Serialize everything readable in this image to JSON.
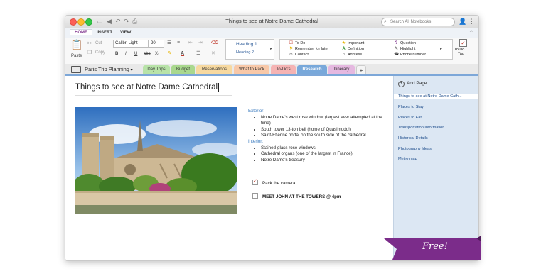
{
  "window": {
    "title": "Things to see at Notre Dame Cathedral",
    "search_placeholder": "Search All Notebooks"
  },
  "ribbon_tabs": [
    {
      "label": "HOME",
      "active": true
    },
    {
      "label": "INSERT",
      "active": false
    },
    {
      "label": "VIEW",
      "active": false
    }
  ],
  "ribbon": {
    "paste_label": "Paste",
    "cut_label": "Cut",
    "copy_label": "Copy",
    "font_name": "Calibri Light",
    "font_size": "20",
    "bold": "B",
    "italic": "I",
    "underline": "U",
    "strike": "abc",
    "subscript": "X₂",
    "styles": [
      "Heading 1",
      "Heading 2"
    ],
    "tags": [
      {
        "icon": "checkbox",
        "label": "To Do",
        "color": "#c0392b"
      },
      {
        "icon": "flag",
        "label": "Remember for later",
        "color": "#e6b400"
      },
      {
        "icon": "person",
        "label": "Contact",
        "color": "#555555"
      },
      {
        "icon": "star",
        "label": "Important",
        "color": "#e6b400"
      },
      {
        "icon": "A",
        "label": "Definition",
        "color": "#2a8a2a"
      },
      {
        "icon": "house",
        "label": "Address",
        "color": "#555555"
      },
      {
        "icon": "question",
        "label": "Question",
        "color": "#7b2c8a"
      },
      {
        "icon": "highlight",
        "label": "Highlight",
        "color": "#555555"
      },
      {
        "icon": "phone",
        "label": "Phone number",
        "color": "#555555"
      }
    ],
    "todo_tag_label_1": "To Do",
    "todo_tag_label_2": "Tag"
  },
  "notebook": {
    "name": "Paris Trip Planning",
    "sections": [
      {
        "label": "Day Trips",
        "color": "#b8e3a8"
      },
      {
        "label": "Budget",
        "color": "#a9d88e"
      },
      {
        "label": "Reservations",
        "color": "#f7d9a0"
      },
      {
        "label": "What to Pack",
        "color": "#f8c8a8"
      },
      {
        "label": "To-Do's",
        "color": "#f5b3b3"
      },
      {
        "label": "Research",
        "color": "#78a8da",
        "active": true
      },
      {
        "label": "Itinerary",
        "color": "#e5b8e0"
      },
      {
        "label": "+",
        "color": "#f4f4f4"
      }
    ]
  },
  "page": {
    "title": "Things to see at Notre Dame Cathedral",
    "exterior_heading": "Exterior:",
    "exterior_items": [
      "Notre Dame's west rose window (largest ever attempted at the time)",
      "South tower 13-ton bell (home of Quasimodo!)",
      "Saint-Etienne portal on the south side of the cathedral"
    ],
    "interior_heading": "Interior:",
    "interior_items": [
      "Stained-glass rose windows",
      "Cathedral organs (one of the largest in France)",
      "Notre Dame's treasury"
    ],
    "todos": [
      {
        "label": "Pack the camera",
        "checked": true
      },
      {
        "label": "MEET JOHN AT THE TOWERS @ 4pm",
        "checked": false
      }
    ]
  },
  "sidebar": {
    "add_page": "Add Page",
    "pages": [
      {
        "label": "Things to see at Notre Dame Cath...",
        "selected": true
      },
      {
        "label": "Places to Stay",
        "selected": false
      },
      {
        "label": "Places to Eat",
        "selected": false
      },
      {
        "label": "Transportation Information",
        "selected": false
      },
      {
        "label": "Historical Details",
        "selected": false
      },
      {
        "label": "Photography Ideas",
        "selected": false
      },
      {
        "label": "Metro map",
        "selected": false
      }
    ]
  },
  "badge": {
    "label": "Free!",
    "color": "#7b2c8a"
  }
}
